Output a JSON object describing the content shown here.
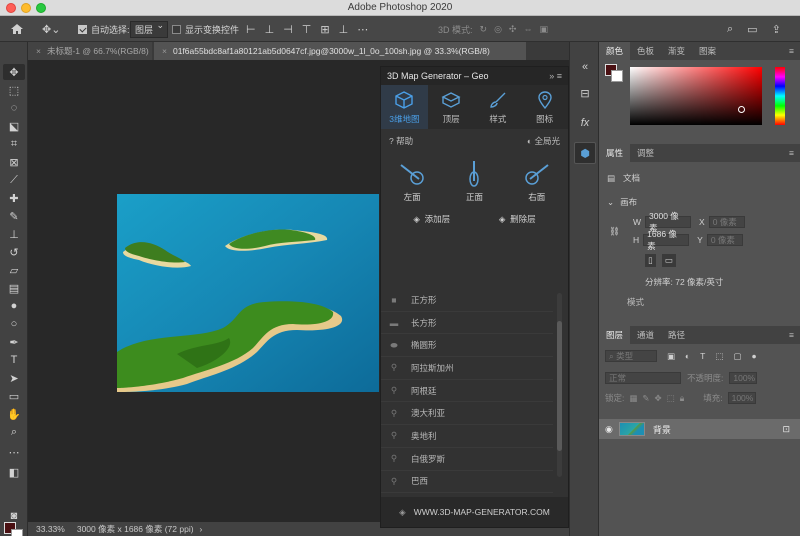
{
  "window": {
    "title": "Adobe Photoshop 2020"
  },
  "options_bar": {
    "auto_select_label": "自动选择:",
    "layer_select_value": "图层",
    "show_transform_label": "显示变换控件",
    "mode_3d_label": "3D 模式:"
  },
  "document_tabs": [
    {
      "label": "未标题-1 @ 66.7%(RGB/8)",
      "active": false
    },
    {
      "label": "01f6a55bdc8af1a80121ab5d0647cf.jpg@3000w_1l_0o_100sh.jpg @ 33.3%(RGB/8)",
      "active": true
    }
  ],
  "status": {
    "zoom": "33.33%",
    "doc_info": "3000 像素 x 1686 像素 (72 ppi)"
  },
  "plugin": {
    "title": "3D Map Generator – Geo",
    "tabs": [
      {
        "label": "3维地图",
        "icon": "cube-icon",
        "active": true
      },
      {
        "label": "顶层",
        "icon": "layers-cube-icon",
        "active": false
      },
      {
        "label": "样式",
        "icon": "brush-icon",
        "active": false
      },
      {
        "label": "图标",
        "icon": "map-pin-icon",
        "active": false
      }
    ],
    "help_label": "帮助",
    "global_light_label": "全局光",
    "views": [
      "左面",
      "正面",
      "右面"
    ],
    "add_layer_label": "添加层",
    "delete_layer_label": "删除层",
    "shapes": [
      "正方形",
      "长方形",
      "椭圆形",
      "阿拉斯加州",
      "阿根廷",
      "澳大利亚",
      "奥地利",
      "白俄罗斯",
      "巴西"
    ],
    "footer": "WWW.3D-MAP-GENERATOR.COM"
  },
  "color_panel": {
    "tabs": [
      "颜色",
      "色板",
      "渐变",
      "图案"
    ],
    "foreground": "#4a1012",
    "background": "#ffffff"
  },
  "properties_panel": {
    "tabs": [
      "属性",
      "调整"
    ],
    "doc_label": "文档",
    "canvas_label": "画布",
    "width_label": "W",
    "width_value": "3000 像素",
    "x_label": "X",
    "x_placeholder": "0 像素",
    "height_label": "H",
    "height_value": "1686 像素",
    "y_label": "Y",
    "y_placeholder": "0 像素",
    "resolution": "分辨率: 72 像素/英寸",
    "mode_label": "模式"
  },
  "layers_panel": {
    "tabs": [
      "图层",
      "通道",
      "路径"
    ],
    "filter_placeholder": "类型",
    "blend_mode": "正常",
    "opacity_label": "不透明度:",
    "opacity_value": "100%",
    "lock_label": "锁定:",
    "fill_label": "填充:",
    "fill_value": "100%",
    "layers": [
      {
        "name": "背景",
        "visible": true,
        "locked": true
      }
    ]
  }
}
